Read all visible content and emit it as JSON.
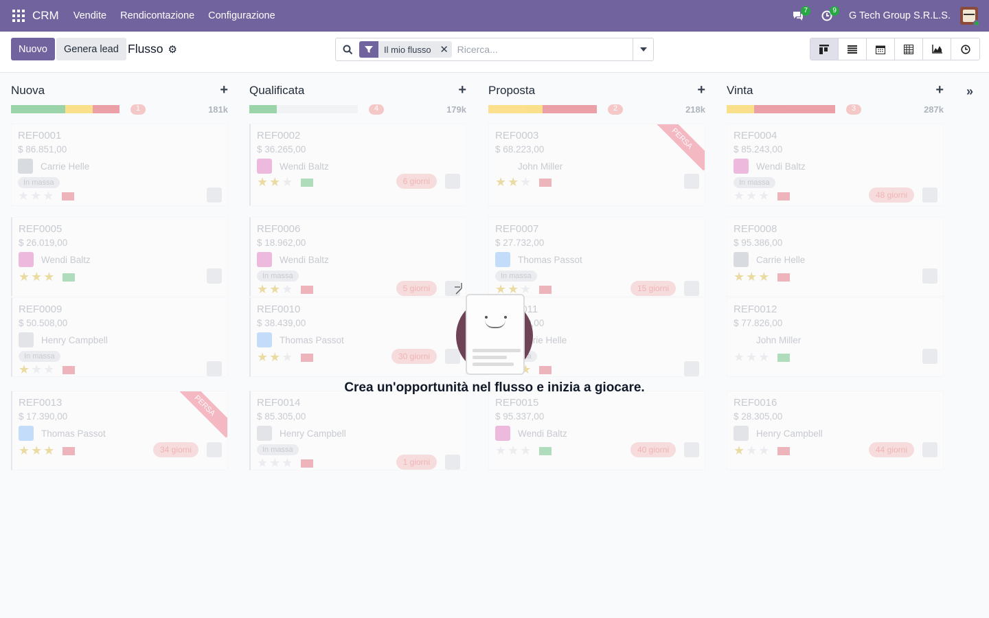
{
  "navbar": {
    "app_name": "CRM",
    "menu": [
      "Vendite",
      "Rendicontazione",
      "Configurazione"
    ],
    "messages_count": "7",
    "activities_count": "9",
    "company": "G Tech Group S.R.L.S.",
    "apps_icon": "grid-icon",
    "brand_color": "#71639e"
  },
  "control": {
    "new_label": "Nuovo",
    "generate_label": "Genera lead",
    "breadcrumb": "Flusso",
    "search": {
      "facet_value": "Il mio flusso",
      "placeholder": "Ricerca..."
    },
    "views": [
      "kanban-view-icon",
      "list-view-icon",
      "calendar-view-icon",
      "pivot-view-icon",
      "graph-view-icon",
      "activity-view-icon"
    ]
  },
  "kanban": {
    "columns": [
      {
        "title": "Nuova",
        "count": "1",
        "total": "181k",
        "progress": [
          {
            "color": "#28a745",
            "pct": 50
          },
          {
            "color": "#ffc107",
            "pct": 25
          },
          {
            "color": "#dc3545",
            "pct": 25
          }
        ],
        "cards": [
          {
            "ref": "REF0001",
            "amount": "$ 86.851,00",
            "person": "Carrie Helle",
            "tag": "In massa",
            "stars": 0,
            "days": ""
          },
          {
            "ref": "REF0005",
            "amount": "$ 26.019,00",
            "person": "Wendi Baltz",
            "tag": "",
            "stars": 3,
            "days": ""
          },
          {
            "ref": "REF0009",
            "amount": "$ 50.508,00",
            "person": "Henry Campbell",
            "tag": "In massa",
            "stars": 1,
            "days": ""
          },
          {
            "ref": "REF0013",
            "amount": "$ 17.390,00",
            "person": "Thomas Passot",
            "tag": "",
            "stars": 3,
            "days": "34 giorni",
            "ribbon": "PERSA"
          }
        ]
      },
      {
        "title": "Qualificata",
        "count": "4",
        "total": "179k",
        "progress": [
          {
            "color": "#28a745",
            "pct": 25
          },
          {
            "color": "#e9ecef",
            "pct": 75
          }
        ],
        "cards": [
          {
            "ref": "REF0002",
            "amount": "$ 36.265,00",
            "person": "Wendi Baltz",
            "tag": "",
            "stars": 2,
            "days": "6 giorni"
          },
          {
            "ref": "REF0006",
            "amount": "$ 18.962,00",
            "person": "Wendi Baltz",
            "tag": "In massa",
            "stars": 2,
            "days": "5 giorni"
          },
          {
            "ref": "REF0010",
            "amount": "$ 38.439,00",
            "person": "Thomas Passot",
            "tag": "",
            "stars": 2,
            "days": "30 giorni"
          },
          {
            "ref": "REF0014",
            "amount": "$ 85.305,00",
            "person": "Henry Campbell",
            "tag": "In massa",
            "stars": 0,
            "days": "1 giorni"
          }
        ]
      },
      {
        "title": "Proposta",
        "count": "2",
        "total": "218k",
        "progress": [
          {
            "color": "#ffc107",
            "pct": 50
          },
          {
            "color": "#dc3545",
            "pct": 50
          }
        ],
        "cards": [
          {
            "ref": "REF0003",
            "amount": "$ 68.223,00",
            "person": "John Miller",
            "tag": "",
            "stars": 2,
            "days": "",
            "ribbon": "PERSA"
          },
          {
            "ref": "REF0007",
            "amount": "$ 27.732,00",
            "person": "Thomas Passot",
            "tag": "In massa",
            "stars": 2,
            "days": "15 giorni"
          },
          {
            "ref": "REF0011",
            "amount": "$ 55.000,00",
            "person": "Carrie Helle",
            "tag": "In massa",
            "stars": 3,
            "days": ""
          },
          {
            "ref": "REF0015",
            "amount": "$ 95.337,00",
            "person": "Wendi Baltz",
            "tag": "",
            "stars": 0,
            "days": "40 giorni"
          }
        ]
      },
      {
        "title": "Vinta",
        "count": "3",
        "total": "287k",
        "progress": [
          {
            "color": "#ffc107",
            "pct": 25
          },
          {
            "color": "#dc3545",
            "pct": 75
          }
        ],
        "cards": [
          {
            "ref": "REF0004",
            "amount": "$ 85.243,00",
            "person": "Wendi Baltz",
            "tag": "In massa",
            "stars": 0,
            "days": "48 giorni"
          },
          {
            "ref": "REF0008",
            "amount": "$ 95.386,00",
            "person": "Carrie Helle",
            "tag": "",
            "stars": 3,
            "days": ""
          },
          {
            "ref": "REF0012",
            "amount": "$ 77.826,00",
            "person": "John Miller",
            "tag": "",
            "stars": 0,
            "days": ""
          },
          {
            "ref": "REF0016",
            "amount": "$ 28.305,00",
            "person": "Henry Campbell",
            "tag": "",
            "stars": 1,
            "days": "44 giorni"
          }
        ]
      }
    ]
  },
  "empty_state": {
    "title": "Crea un'opportunità nel flusso e inizia a giocare."
  }
}
